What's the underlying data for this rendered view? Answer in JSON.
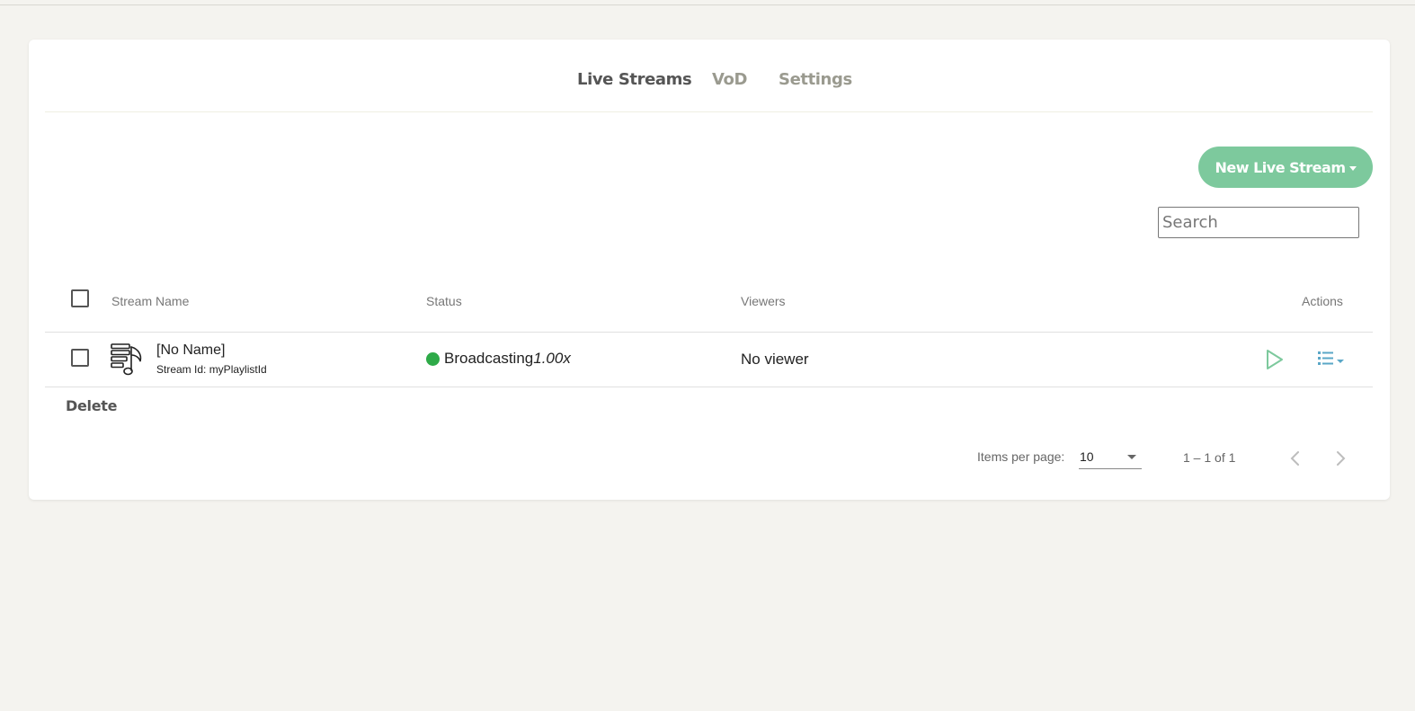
{
  "tabs": [
    {
      "label": "Live Streams",
      "active": true
    },
    {
      "label": "VoD",
      "active": false
    },
    {
      "label": "Settings",
      "active": false
    }
  ],
  "toolbar": {
    "new_stream_label": "New Live Stream"
  },
  "search": {
    "placeholder": "Search",
    "value": ""
  },
  "table": {
    "columns": {
      "stream_name": "Stream Name",
      "status": "Status",
      "viewers": "Viewers",
      "actions": "Actions"
    },
    "rows": [
      {
        "name": "[No Name]",
        "stream_id": "Stream Id: myPlaylistId",
        "icon": "playlist-music-icon",
        "status": "Broadcasting",
        "speed": "1.00x",
        "viewers": "No viewer",
        "checked": false
      }
    ]
  },
  "bulk": {
    "delete_label": "Delete"
  },
  "paginator": {
    "items_per_page_label": "Items per page:",
    "page_size": "10",
    "range": "1 – 1 of 1"
  },
  "colors": {
    "accent": "#7dc99d",
    "status_live": "#2eaa48",
    "background": "#f4f3ef"
  }
}
